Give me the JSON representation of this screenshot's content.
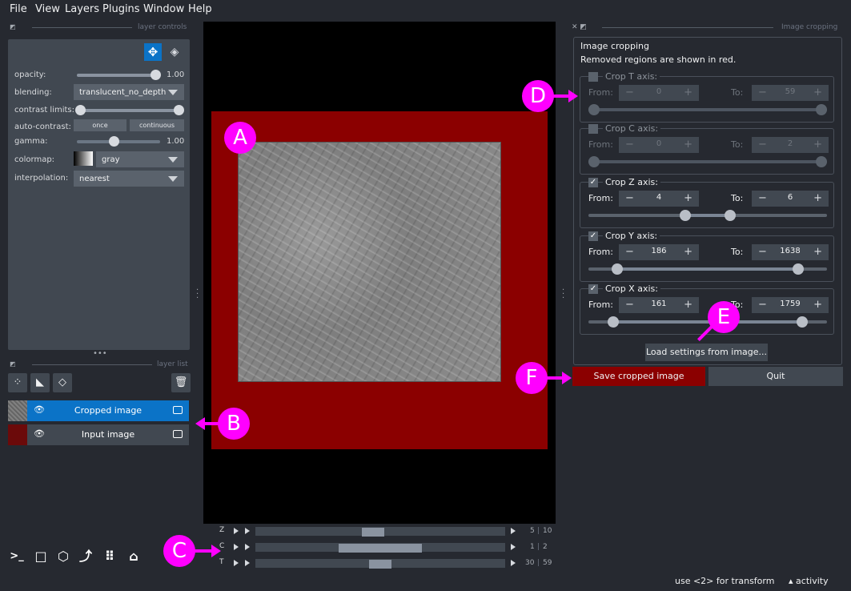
{
  "menu": [
    "File",
    "View",
    "Layers",
    "Plugins",
    "Window",
    "Help"
  ],
  "left_dock": {
    "controls_title": "layer controls",
    "layer_list_title": "layer list",
    "opacity_label": "opacity:",
    "opacity_value": "1.00",
    "blending_label": "blending:",
    "blending_value": "translucent_no_depth",
    "contrast_label": "contrast limits:",
    "auto_contrast_label": "auto-contrast:",
    "once_label": "once",
    "continuous_label": "continuous",
    "gamma_label": "gamma:",
    "gamma_value": "1.00",
    "colormap_label": "colormap:",
    "colormap_value": "gray",
    "interp_label": "interpolation:",
    "interp_value": "nearest",
    "layers": [
      {
        "name": "Cropped image"
      },
      {
        "name": "Input image"
      }
    ]
  },
  "dims": [
    {
      "axis": "Z",
      "current": "5",
      "total": "10",
      "position": 0.47
    },
    {
      "axis": "C",
      "current": "1",
      "total": "2",
      "position": 0.5
    },
    {
      "axis": "T",
      "current": "30",
      "total": "59",
      "position": 0.5
    }
  ],
  "right_dock": {
    "dock_title": "Image cropping",
    "title": "Image cropping",
    "subtitle": "Removed regions are shown in red.",
    "from_label": "From:",
    "to_label": "To:",
    "axes": [
      {
        "label": "Crop T axis:",
        "checked": false,
        "from": "0",
        "to": "59",
        "max": 59
      },
      {
        "label": "Crop C axis:",
        "checked": false,
        "from": "0",
        "to": "2",
        "max": 2
      },
      {
        "label": "Crop Z axis:",
        "checked": true,
        "from": "4",
        "to": "6",
        "max": 10
      },
      {
        "label": "Crop Y axis:",
        "checked": true,
        "from": "186",
        "to": "1638",
        "max": 1824
      },
      {
        "label": "Crop X axis:",
        "checked": true,
        "from": "161",
        "to": "1759",
        "max": 1920
      }
    ],
    "load_label": "Load settings from image...",
    "save_label": "Save cropped image",
    "quit_label": "Quit"
  },
  "status": {
    "left": "use <2> for transform",
    "right": "activity"
  },
  "annotations": [
    "A",
    "B",
    "C",
    "D",
    "E",
    "F"
  ],
  "colors": {
    "accent": "#0b73c7",
    "crop_red": "#8b0000",
    "annotation": "#ff00ff"
  }
}
